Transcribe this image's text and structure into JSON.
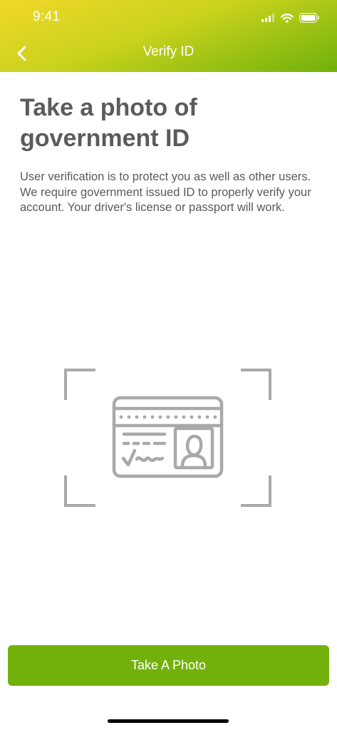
{
  "status_bar": {
    "time": "9:41",
    "icons": [
      "cellular-signal-icon",
      "wifi-icon",
      "battery-icon"
    ]
  },
  "nav": {
    "back_icon": "chevron-left-icon",
    "title": "Verify ID"
  },
  "main": {
    "title": "Take a photo of government ID",
    "description": "User verification is to protect you as well as other users. We require government issued ID to properly verify your account. Your driver's license or passport will work.",
    "illustration_icon": "id-card-scan-icon"
  },
  "actions": {
    "take_photo_label": "Take A Photo"
  },
  "colors": {
    "header_gradient": [
      "#f2d82a",
      "#c9d21d",
      "#6fb10c"
    ],
    "primary_button": "#72b10b",
    "title_text": "#5b5b5b",
    "body_text": "#5a5a5a",
    "illustration": "#a9a9a9"
  }
}
